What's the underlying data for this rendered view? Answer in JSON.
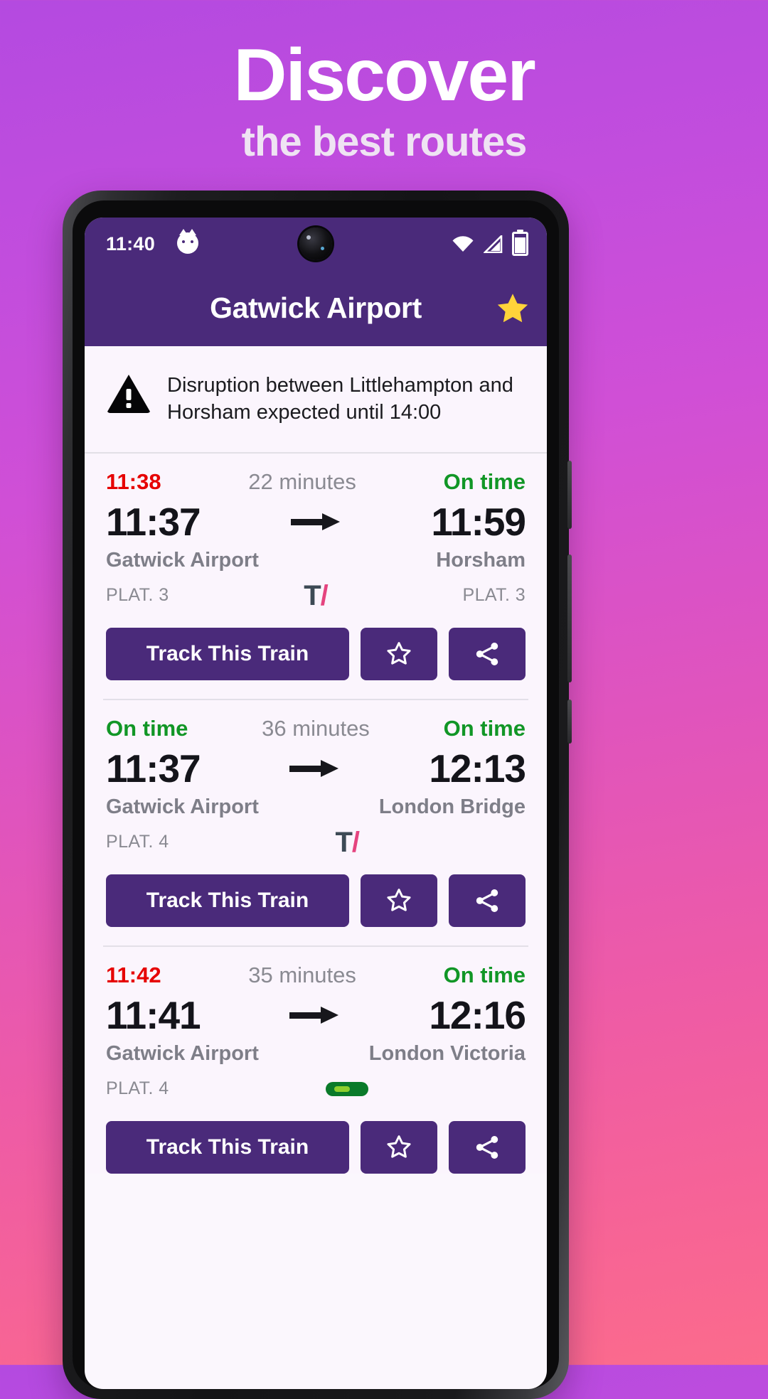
{
  "promo": {
    "title": "Discover",
    "subtitle": "the best routes"
  },
  "statusbar": {
    "time": "11:40",
    "cat_icon": "cat-icon",
    "wifi_icon": "wifi-icon",
    "signal_icon": "cellular-signal-icon",
    "battery_icon": "battery-icon"
  },
  "appbar": {
    "title": "Gatwick Airport",
    "favourite_icon": "star-filled-icon"
  },
  "disruption": {
    "icon": "warning-triangle-icon",
    "text": "Disruption between Littlehampton and Horsham expected until 14:00"
  },
  "actions": {
    "track_label": "Track This Train",
    "favourite_icon": "star-outline-icon",
    "share_icon": "share-icon"
  },
  "colors": {
    "brand_purple": "#4A2A7A",
    "late_red": "#E60000",
    "ontime_green": "#119626",
    "muted_grey": "#8A8A92",
    "thameslink_dark": "#3D4A55",
    "thameslink_pink": "#E5447F",
    "southern_green": "#0A7A2A"
  },
  "trains": [
    {
      "status_left": "11:38",
      "status_left_state": "late",
      "duration": "22 minutes",
      "status_right": "On time",
      "status_right_state": "ontime",
      "dep_time": "11:37",
      "arr_time": "11:59",
      "origin": "Gatwick Airport",
      "destination": "Horsham",
      "origin_platform": "PLAT. 3",
      "dest_platform": "PLAT. 3",
      "operator": "thameslink"
    },
    {
      "status_left": "On time",
      "status_left_state": "ontime",
      "duration": "36 minutes",
      "status_right": "On time",
      "status_right_state": "ontime",
      "dep_time": "11:37",
      "arr_time": "12:13",
      "origin": "Gatwick Airport",
      "destination": "London Bridge",
      "origin_platform": "PLAT. 4",
      "dest_platform": "",
      "operator": "thameslink"
    },
    {
      "status_left": "11:42",
      "status_left_state": "late",
      "duration": "35 minutes",
      "status_right": "On time",
      "status_right_state": "ontime",
      "dep_time": "11:41",
      "arr_time": "12:16",
      "origin": "Gatwick Airport",
      "destination": "London Victoria",
      "origin_platform": "PLAT. 4",
      "dest_platform": "",
      "operator": "southern"
    }
  ]
}
